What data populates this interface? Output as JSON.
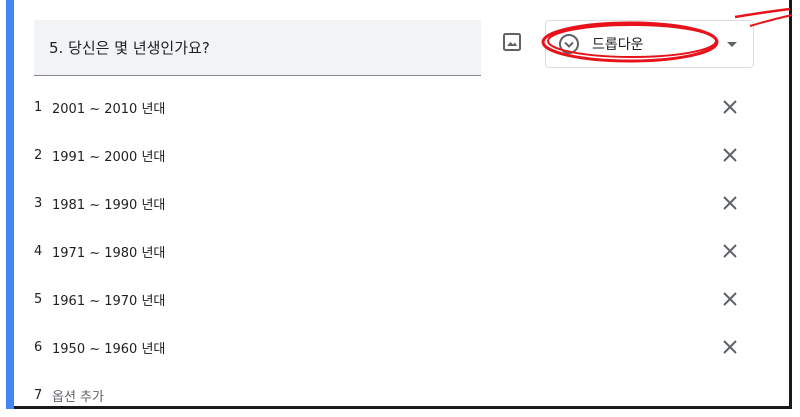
{
  "question": {
    "title": "5. 당신은 몇 년생인가요?"
  },
  "toolbar": {
    "image_icon": "image-icon"
  },
  "type_select": {
    "label": "드롭다운",
    "icon": "dropdown-circle-icon"
  },
  "options": [
    {
      "num": "1",
      "label": "2001 ~ 2010 년대"
    },
    {
      "num": "2",
      "label": "1991 ~ 2000 년대"
    },
    {
      "num": "3",
      "label": "1981 ~ 1990 년대"
    },
    {
      "num": "4",
      "label": "1971 ~ 1980 년대"
    },
    {
      "num": "5",
      "label": "1961 ~ 1970 년대"
    },
    {
      "num": "6",
      "label": "1950 ~ 1960 년대"
    }
  ],
  "add_option": {
    "num": "7",
    "label": "옵션 추가"
  },
  "colors": {
    "accent": "#4285f4",
    "annotation": "#e8121b"
  }
}
